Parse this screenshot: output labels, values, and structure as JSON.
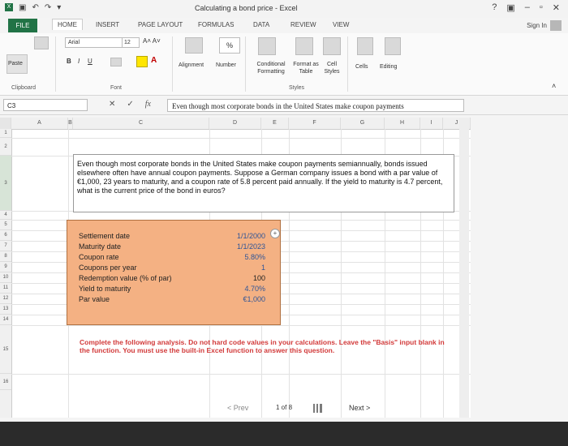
{
  "window": {
    "title": "Calculating a bond price - Excel",
    "help": "?",
    "min": "–",
    "restore": "▫",
    "close": "✕"
  },
  "tabs": {
    "file": "FILE",
    "home": "HOME",
    "insert": "INSERT",
    "page_layout": "PAGE LAYOUT",
    "formulas": "FORMULAS",
    "data": "DATA",
    "review": "REVIEW",
    "view": "VIEW",
    "sign_in": "Sign In"
  },
  "ribbon": {
    "paste": "Paste",
    "font_name": "Arial",
    "font_size": "12",
    "alignment": "Alignment",
    "number": "Number",
    "conditional_formatting": "Conditional Formatting",
    "format_as_table": "Format as Table",
    "cell_styles": "Cell Styles",
    "cells": "Cells",
    "editing": "Editing",
    "group_clipboard": "Clipboard",
    "group_font": "Font",
    "group_styles": "Styles",
    "percent": "%"
  },
  "formula_bar": {
    "name_box": "C3",
    "content": "Even though most corporate bonds in the United States make coupon payments"
  },
  "columns": [
    "A",
    "B",
    "C",
    "D",
    "E",
    "F",
    "G",
    "H",
    "I",
    "J"
  ],
  "rows": [
    "1",
    "2",
    "3",
    "4",
    "5",
    "6",
    "7",
    "8",
    "9",
    "10",
    "11",
    "12",
    "13",
    "14",
    "15",
    "16"
  ],
  "question": "Even though most corporate bonds in the United States make coupon payments semiannually, bonds issued elsewhere often have annual coupon payments. Suppose a German company issues a bond with a par value of €1,000, 23 years to maturity, and a coupon rate of 5.8 percent paid annually. If the yield to maturity is 4.7 percent, what is the current price of the bond in euros?",
  "inputs": [
    {
      "label": "Settlement date",
      "value": "1/1/2000"
    },
    {
      "label": "Maturity date",
      "value": "1/1/2023"
    },
    {
      "label": "Coupon rate",
      "value": "5.80%"
    },
    {
      "label": "Coupons per year",
      "value": "1"
    },
    {
      "label": "Redemption value (% of par)",
      "value": "100"
    },
    {
      "label": "Yield to maturity",
      "value": "4.70%"
    },
    {
      "label": "Par value",
      "value": "€1,000"
    }
  ],
  "note": "Complete the following analysis. Do not hard code values in your calculations. Leave the \"Basis\" input blank in the function. You must use the built-in Excel function to answer this question.",
  "pager": {
    "prev": "< Prev",
    "page": "1 of 8",
    "next": "Next >"
  }
}
